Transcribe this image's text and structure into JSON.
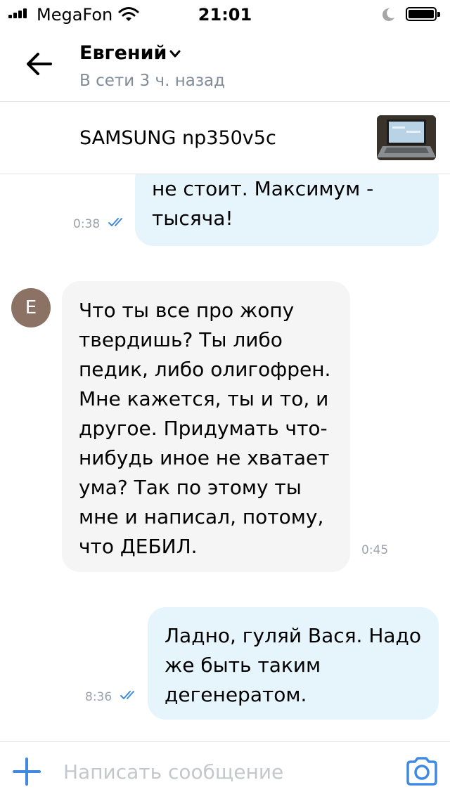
{
  "status_bar": {
    "carrier": "MegaFon",
    "time": "21:01"
  },
  "header": {
    "contact_name": "Евгений",
    "contact_status": "В сети 3 ч. назад"
  },
  "pinned_product": {
    "title": "SAMSUNG np350v5c"
  },
  "messages": [
    {
      "direction": "outgoing",
      "lines": [
        "не стоит. Максимум -",
        "тысяча!"
      ],
      "time": "0:38",
      "read": true
    },
    {
      "direction": "incoming",
      "avatar_letter": "Е",
      "lines": [
        "Что ты все про жопу",
        "твердишь? Ты либо",
        "педик, либо олигофрен.",
        "Мне кажется, ты и то, и",
        "другое. Придумать что-",
        "нибудь иное не хватает",
        "ума? Так по этому ты",
        "мне и написал, потому,",
        "что ДЕБИЛ."
      ],
      "time": "0:45"
    },
    {
      "direction": "outgoing",
      "lines": [
        "Ладно, гуляй Вася. Надо",
        "же быть таким",
        "дегенератом."
      ],
      "time": "8:36",
      "read": true
    }
  ],
  "composer": {
    "placeholder": "Написать сообщение"
  },
  "colors": {
    "accent": "#3f8ae0",
    "outgoing_bubble": "#e6f4fc",
    "incoming_bubble": "#f5f5f6",
    "secondary_text": "#818c99"
  },
  "icons": {
    "back": "arrow-left-icon",
    "dropdown": "chevron-down-icon",
    "read": "double-check-icon",
    "attach": "plus-icon",
    "camera": "camera-icon"
  }
}
